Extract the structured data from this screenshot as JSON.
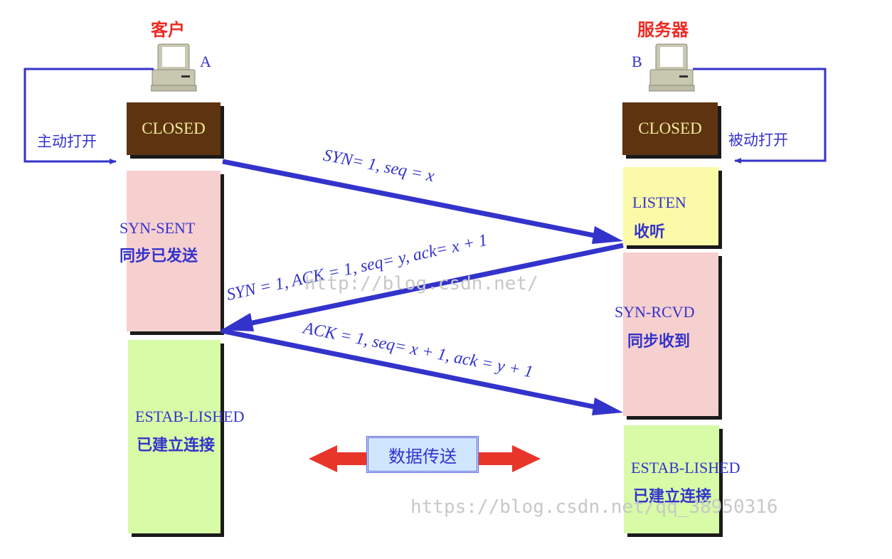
{
  "client": {
    "title": "客户",
    "letter": "A",
    "open_label": "主动打开",
    "states": [
      {
        "en": "CLOSED",
        "zh": ""
      },
      {
        "en": "SYN-SENT",
        "zh": "同步已发送"
      },
      {
        "en": "ESTAB-LISHED",
        "zh": "已建立连接"
      }
    ]
  },
  "server": {
    "title": "服务器",
    "letter": "B",
    "open_label": "被动打开",
    "states": [
      {
        "en": "CLOSED",
        "zh": ""
      },
      {
        "en": "LISTEN",
        "zh": "收听"
      },
      {
        "en": "SYN-RCVD",
        "zh": "同步收到"
      },
      {
        "en": "ESTAB-LISHED",
        "zh": "已建立连接"
      }
    ]
  },
  "messages": [
    {
      "label": "SYN= 1, seq = x",
      "direction": "client-to-server"
    },
    {
      "label": "SYN = 1, ACK = 1, seq= y, ack= x + 1",
      "direction": "server-to-client"
    },
    {
      "label": "ACK = 1, seq= x + 1, ack = y + 1",
      "direction": "client-to-server"
    }
  ],
  "data_transfer": {
    "label": "数据传送"
  },
  "watermarks": [
    "http://blog.csdn.net/",
    "https://blog.csdn.net/qq_38950316"
  ],
  "colors": {
    "arrow": "#3333cc",
    "title": "#ee2a22",
    "closed_bg": "#5e3410",
    "syn_bg": "#f6cfcf",
    "listen_bg": "#fbfaa8",
    "established_bg": "#d7fba6",
    "data_arrow": "#e8352a"
  }
}
